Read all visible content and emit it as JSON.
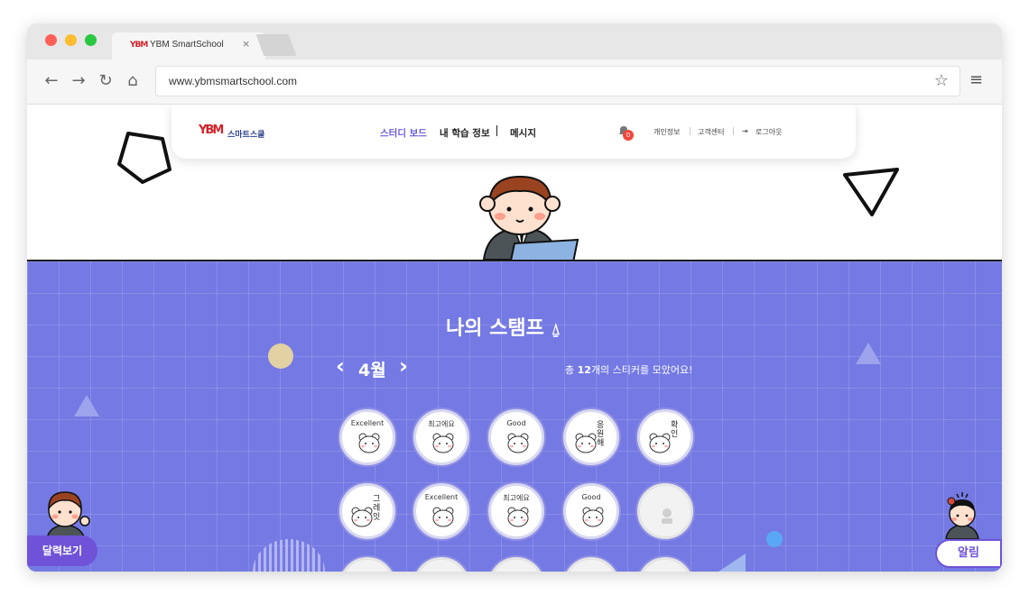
{
  "browser": {
    "tab_title": "YBM SmartSchool",
    "tab_logo": "YBM",
    "tab_close": "×",
    "url": "www.ybmsmartschool.com",
    "dot_colors": [
      "#ff5f57",
      "#febc2e",
      "#28c840"
    ]
  },
  "header": {
    "logo_mark": "YBM",
    "logo_text": "스마트스쿨",
    "nav": [
      "스터디 보드",
      "내 학습 정보",
      "메시지"
    ],
    "notification_count": "0",
    "links": [
      "개인정보",
      "고객센터",
      "로그아웃"
    ]
  },
  "main": {
    "title": "나의 스탬프",
    "month": "4월",
    "total_prefix": "총 ",
    "total_count": "12",
    "total_suffix": "개의 스티커를 모았어요!",
    "stickers": [
      {
        "label": "Excellent",
        "vertical": ""
      },
      {
        "label": "최고에요",
        "vertical": ""
      },
      {
        "label": "Good",
        "vertical": ""
      },
      {
        "label": "",
        "vertical": "응원해"
      },
      {
        "label": "",
        "vertical": "확인"
      },
      {
        "label": "",
        "vertical": "그레잇"
      },
      {
        "label": "Excellent",
        "vertical": ""
      },
      {
        "label": "최고에요",
        "vertical": ""
      },
      {
        "label": "Good",
        "vertical": ""
      },
      {
        "label": "",
        "vertical": ""
      }
    ]
  },
  "buttons": {
    "calendar": "달력보기",
    "alarm": "알림"
  },
  "colors": {
    "accent": "#6f52d8",
    "background": "#7479e3",
    "brand_red": "#d2232a"
  }
}
